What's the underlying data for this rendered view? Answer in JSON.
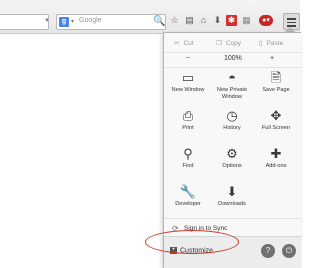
{
  "toolbar": {
    "search_placeholder": "Google",
    "search_engine_letter": "g",
    "icons": [
      "bookmark-star-icon",
      "bookmarks-icon",
      "home-icon",
      "downloads-icon",
      "addon-icon",
      "addon-badge-icon",
      "menu-icon"
    ]
  },
  "edit": {
    "cut": "Cut",
    "copy": "Copy",
    "paste": "Paste"
  },
  "zoom": {
    "minus": "−",
    "level": "100%",
    "plus": "+"
  },
  "tiles": [
    {
      "label": "New Window",
      "icon": "new-window-icon",
      "glyph": "▭"
    },
    {
      "label": "New Private Window",
      "icon": "private-mask-icon",
      "glyph": "◓"
    },
    {
      "label": "Save Page",
      "icon": "save-page-icon",
      "glyph": "🗎"
    },
    {
      "label": "Print",
      "icon": "printer-icon",
      "glyph": "⎙"
    },
    {
      "label": "History",
      "icon": "clock-icon",
      "glyph": "◷"
    },
    {
      "label": "Full Screen",
      "icon": "fullscreen-icon",
      "glyph": "✥"
    },
    {
      "label": "Find",
      "icon": "magnifier-icon",
      "glyph": "⚲"
    },
    {
      "label": "Options",
      "icon": "gear-icon",
      "glyph": "⚙"
    },
    {
      "label": "Add-ons",
      "icon": "puzzle-icon",
      "glyph": "✚"
    },
    {
      "label": "Developer",
      "icon": "wrench-icon",
      "glyph": "🔧"
    },
    {
      "label": "Downloads",
      "icon": "download-arrow-icon",
      "glyph": "⬇"
    }
  ],
  "sync": {
    "label": "Sign in to Sync"
  },
  "footer": {
    "customize": "Customize",
    "help": "?",
    "quit": "⏻"
  },
  "colors": {
    "panel_bg": "#f8f8f8",
    "annotation": "#d13a2a",
    "search_engine": "#4a86e8"
  }
}
